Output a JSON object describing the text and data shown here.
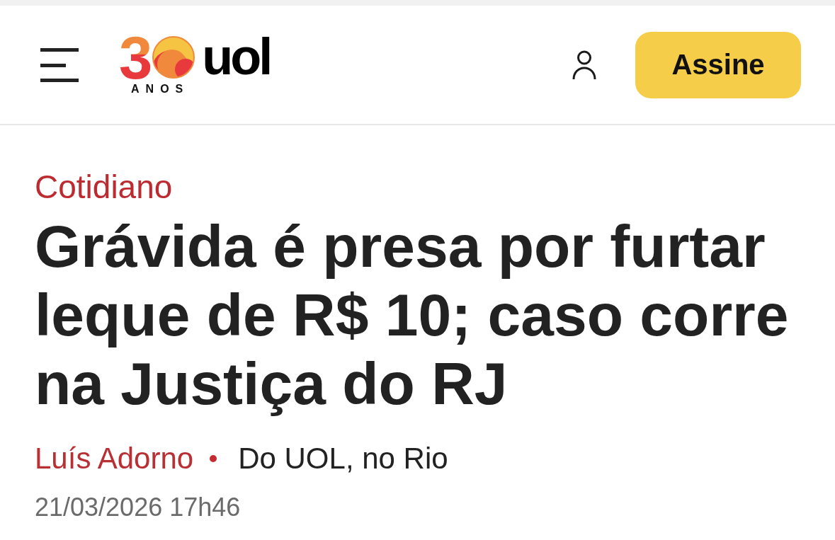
{
  "header": {
    "logo": {
      "numeral": "3",
      "caption": "ANOS",
      "wordmark": "uol"
    },
    "subscribe_button": "Assine"
  },
  "article": {
    "category": "Cotidiano",
    "headline": "Grávida é presa por furtar leque de R$ 10; caso corre na Justiça do RJ",
    "author": "Luís Adorno",
    "source": "Do UOL, no Rio",
    "timestamp": "21/03/2026 17h46"
  }
}
